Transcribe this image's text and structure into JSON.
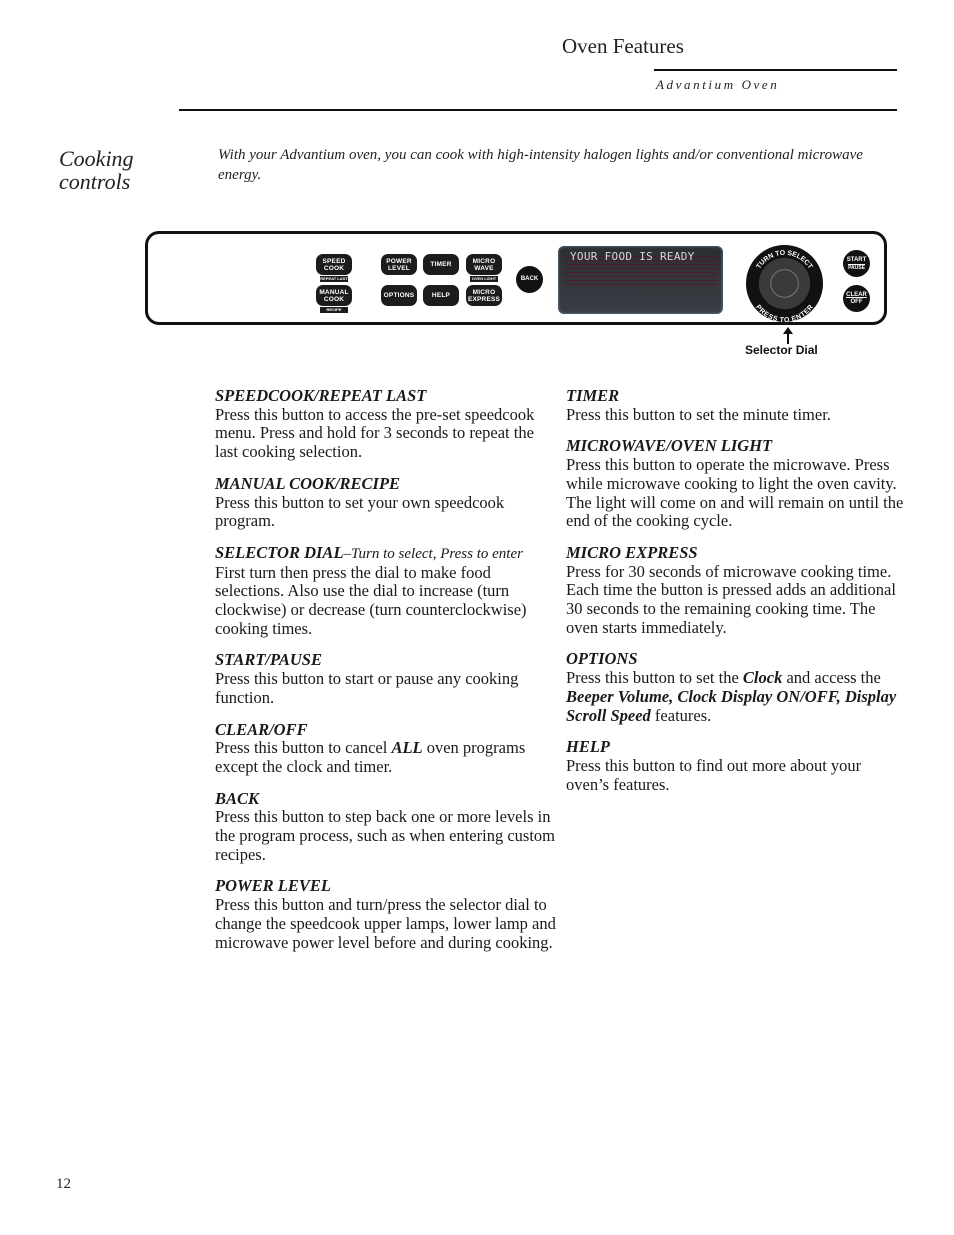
{
  "header": {
    "title": "Oven Features",
    "subtitle": "Advantium Oven"
  },
  "section": {
    "title_line1": "Cooking",
    "title_line2": "controls",
    "intro": "With your Advantium oven, you can cook with high-intensity halogen lights and/or conventional microwave energy."
  },
  "panel": {
    "buttons": {
      "speed_cook": {
        "line1": "SPEED",
        "line2": "COOK",
        "sub": "REPEAT LAST"
      },
      "manual_cook": {
        "line1": "MANUAL",
        "line2": "COOK",
        "sub": "RECIPE"
      },
      "power_level": {
        "line1": "POWER",
        "line2": "LEVEL"
      },
      "timer": {
        "line1": "TIMER"
      },
      "micro_wave": {
        "line1": "MICRO",
        "line2": "WAVE",
        "sub": "OVEN LIGHT"
      },
      "options": {
        "line1": "OPTIONS"
      },
      "help": {
        "line1": "HELP"
      },
      "micro_express": {
        "line1": "MICRO",
        "line2": "EXPRESS"
      },
      "back": {
        "line1": "BACK"
      },
      "start": {
        "line1": "START",
        "line2": "PAUSE"
      },
      "clear": {
        "line1": "CLEAR",
        "line2": "OFF"
      }
    },
    "display_message": "YOUR FOOD IS READY",
    "dial": {
      "top_text": "TURN TO SELECT",
      "bottom_text": "PRESS TO ENTER",
      "callout": "Selector Dial"
    }
  },
  "descriptions": {
    "left": [
      {
        "heading": "SPEEDCOOK/REPEAT LAST",
        "text": "Press this button to access the pre-set speedcook menu. Press and hold for 3 seconds to repeat the last cooking selection."
      },
      {
        "heading": "MANUAL COOK/RECIPE",
        "text": "Press this button to set your own speedcook program."
      },
      {
        "heading": "SELECTOR DIAL",
        "heading_sub": "–Turn to select, Press to enter",
        "text": "First turn then press the dial to make food selections. Also use the dial to increase (turn clockwise) or decrease (turn counterclockwise) cooking times."
      },
      {
        "heading": "START/PAUSE",
        "text": "Press this button to start or pause any cooking function."
      },
      {
        "heading": "CLEAR/OFF",
        "text_before": "Press this button to cancel ",
        "text_emph": "ALL",
        "text_after": " oven programs except the clock and timer."
      },
      {
        "heading": "BACK",
        "text": "Press this button to step back one or more levels in the program process, such as when entering custom recipes."
      },
      {
        "heading": "POWER LEVEL",
        "text": "Press this button and turn/press the selector dial to change the speedcook upper lamps, lower lamp and microwave power level before and during cooking."
      }
    ],
    "right": [
      {
        "heading": "TIMER",
        "text": "Press this button to set the minute timer."
      },
      {
        "heading": "MICROWAVE/OVEN LIGHT",
        "text": "Press this button to operate the microwave. Press while microwave cooking to light the oven cavity. The light will come on and will remain on until the end of the cooking cycle."
      },
      {
        "heading": "MICRO EXPRESS",
        "text": "Press for 30 seconds of microwave cooking time. Each time the button is pressed adds an additional 30 seconds to the remaining cooking time. The oven starts immediately."
      },
      {
        "heading": "OPTIONS",
        "text_1": "Press this button to set the ",
        "emph_1": "Clock",
        "text_2": " and access the ",
        "emph_2": "Beeper Volume, Clock Display ON/OFF, Display Scroll Speed",
        "text_3": " features."
      },
      {
        "heading": "HELP",
        "text": "Press this button to find out more about your oven’s features."
      }
    ]
  },
  "footer": {
    "page_number": "12"
  }
}
